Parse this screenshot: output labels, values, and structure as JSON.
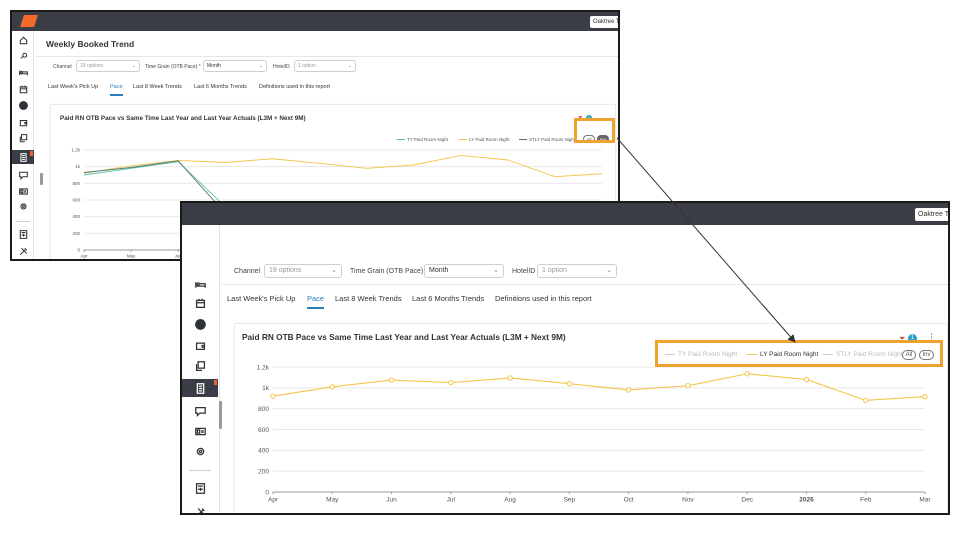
{
  "app": {
    "user_button": "Oaktree Tr"
  },
  "page_title": "Weekly Booked Trend",
  "filters": {
    "channel_label": "Channel",
    "channel_placeholder": "19 options",
    "timegrain_label": "Time Grain (OTB Pace)",
    "timegrain_required": "*",
    "timegrain_value": "Month",
    "hotel_label": "HotelID",
    "hotel_placeholder": "1 option"
  },
  "tabs": [
    {
      "label": "Last Week's Pick Up",
      "active": false
    },
    {
      "label": "Pace",
      "active": true
    },
    {
      "label": "Last 8 Week Trends",
      "active": false
    },
    {
      "label": "Last 6 Months Trends",
      "active": false
    },
    {
      "label": "Definitions used in this report",
      "active": false
    }
  ],
  "chart_card": {
    "title": "Paid RN OTB Pace vs Same Time Last Year and Last Year Actuals (L3M + Next 9M)",
    "filter_badge": "1",
    "legend": [
      "TY Paid Room Night",
      "LY Paid Room Night",
      "STLY Paid Room Night"
    ],
    "pill_all": "All",
    "pill_inv": "Inv"
  },
  "chart_data": {
    "type": "line",
    "x": [
      "Apr",
      "May",
      "Jun",
      "Jul",
      "Aug",
      "Sep",
      "Oct",
      "Nov",
      "Dec",
      "2026",
      "Feb",
      "Mar"
    ],
    "y_ticks": [
      "0",
      "200",
      "400",
      "600",
      "800",
      "1k",
      "1.2k"
    ],
    "ylim": [
      0,
      1200
    ],
    "series": [
      {
        "name": "TY Paid Room Night",
        "color": "#5cc3a6",
        "values": [
          900,
          980,
          1060,
          520,
          80,
          40,
          210,
          10,
          5,
          5,
          45,
          10
        ]
      },
      {
        "name": "LY Paid Room Night",
        "color": "#f3c547",
        "values": [
          920,
          1010,
          1075,
          1050,
          1095,
          1040,
          980,
          1020,
          1135,
          1080,
          880,
          915
        ]
      },
      {
        "name": "STLY Paid Room Night",
        "color": "#4f7478",
        "values": [
          930,
          990,
          1070,
          440,
          115,
          175,
          0,
          0,
          0,
          0,
          5,
          0
        ]
      }
    ],
    "grid": true,
    "legend_position": "top-right",
    "zoom_view_visible_series": [
      "LY Paid Room Night"
    ]
  },
  "colors": {
    "accent": "#2a7fb8",
    "highlight": "#f0a22e",
    "topbar": "#3a3d45",
    "badge": "#2aa0c8"
  },
  "icons": {
    "logo": "brand-logo-icon",
    "sidebar_top": [
      "home-icon",
      "key-icon",
      "bed-icon",
      "calendar-icon",
      "dollar-icon",
      "wallet-icon",
      "copy-icon",
      "report-icon",
      "chat-icon",
      "id-card-icon",
      "settings-icon",
      "calculator-icon",
      "tools-icon"
    ]
  }
}
